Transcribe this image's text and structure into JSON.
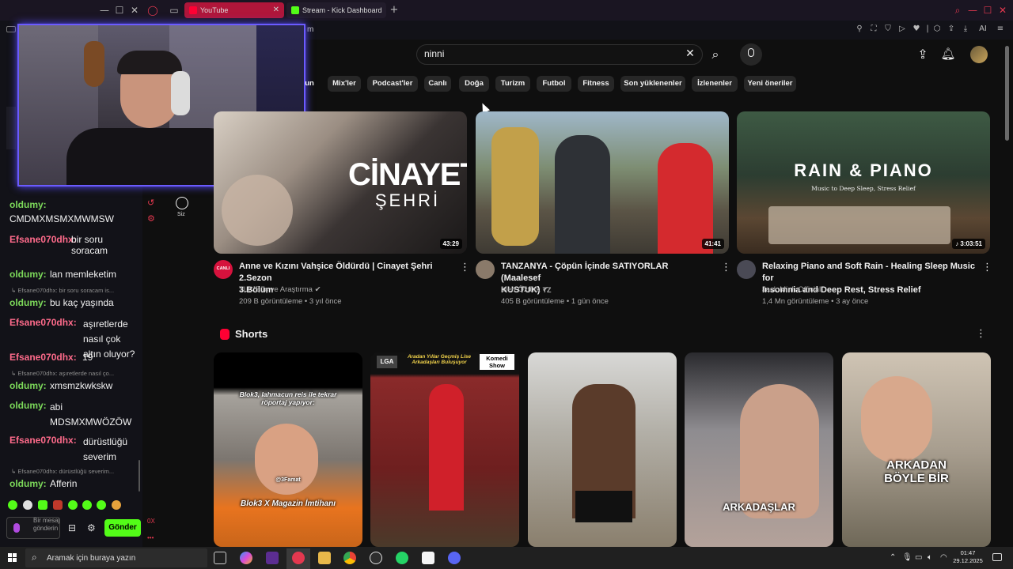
{
  "browser": {
    "tabs": [
      {
        "label": "YouTube",
        "active": true
      },
      {
        "label": "Stream - Kick Dashboard",
        "active": false
      }
    ],
    "new_tab": "+",
    "ai_label": "AI",
    "partial_m": "m"
  },
  "youtube": {
    "search_value": "ninni",
    "chips": [
      "un",
      "Mix'ler",
      "Podcast'ler",
      "Canlı",
      "Doğa",
      "Turizm",
      "Futbol",
      "Fitness",
      "Son yüklenenler",
      "İzlenenler",
      "Yeni öneriler"
    ],
    "sidebar_you_label": "Siz",
    "videos": [
      {
        "title_line1": "Anne ve Kızını Vahşice Öldürdü | Cinayet Şehri 2.Sezon",
        "title_line2": "3.Bölüm",
        "channel": "TLC Suç ve Araştırma",
        "meta": "209 B görüntüleme • 3 yıl önce",
        "duration": "43:29",
        "thumb_text1": "CİNAYET",
        "thumb_text2": "ŞEHRİ",
        "avatar_text": "CANLI"
      },
      {
        "title_line1": "TANZANYA - Çöpün İçinde SATIYORLAR (Maalesef",
        "title_line2": "KUSTUK)",
        "title_suffix": "TZ",
        "channel": "Mert Öztürk",
        "meta": "405 B görüntüleme • 1 gün önce",
        "duration": "41:41"
      },
      {
        "title_line1": "Relaxing Piano and Soft Rain - Healing Sleep Music for",
        "title_line2": "Insomnia and Deep Rest, Stress Relief",
        "channel": "Jack Minh Official",
        "meta": "1,4 Mn görüntüleme • 3 ay önce",
        "duration": "3:03:51",
        "thumb_text1": "RAIN & PIANO",
        "thumb_text2": "Music to Deep Sleep, Stress Relief"
      }
    ],
    "shorts_title": "Shorts",
    "shorts": [
      {
        "caption_top": "Blok3, lahmacun reis ile tekrar röportaj yapıyor:",
        "caption_bottom": "Blok3 X Magazin İmtihanı",
        "handle": "@3Famat"
      },
      {
        "caption_top": "Aradan Yıllar Geçmiş Lise Arkadaşları Buluşuyor",
        "badge": "Komedi Show",
        "logo": "LGA"
      },
      {},
      {
        "caption_bottom": "ARKADAŞLAR"
      },
      {
        "caption_bottom": "ARKADAN BÖYLE BİR"
      }
    ]
  },
  "chat": {
    "messages": [
      {
        "type": "msg",
        "user": "oldumy:",
        "text": "CMDMXMSMXMWMSW",
        "color": "#7cd95a"
      },
      {
        "type": "msg",
        "user": "Efsane070dhx:",
        "text": "bir soru soracam",
        "color": "#ff6b8b"
      },
      {
        "type": "msg",
        "user": "oldumy:",
        "text": "lan memleketim",
        "color": "#7cd95a"
      },
      {
        "type": "reply",
        "text": "↳ Efsane070dhx: bir soru soracam is..."
      },
      {
        "type": "msg",
        "user": "oldumy:",
        "text": "bu kaç yaşında",
        "color": "#7cd95a"
      },
      {
        "type": "msg",
        "user": "Efsane070dhx:",
        "text": "aşıretlerde nasıl çok altın oluyor?",
        "color": "#ff6b8b"
      },
      {
        "type": "msg",
        "user": "Efsane070dhx:",
        "text": "19",
        "color": "#ff6b8b"
      },
      {
        "type": "reply",
        "text": "↳ Efsane070dhx: aşıretlerde nasıl ço..."
      },
      {
        "type": "msg",
        "user": "oldumy:",
        "text": "xmsmzkwkskw",
        "color": "#7cd95a"
      },
      {
        "type": "msg",
        "user": "oldumy:",
        "text": "abi MDSMXMWÖZÖW",
        "color": "#7cd95a"
      },
      {
        "type": "msg",
        "user": "Efsane070dhx:",
        "text": "dürüstlüğü severim",
        "color": "#ff6b8b"
      },
      {
        "type": "reply",
        "text": "↳ Efsane070dhx: dürüstlüğü severim..."
      },
      {
        "type": "msg",
        "user": "oldumy:",
        "text": "Afferin",
        "color": "#7cd95a"
      }
    ],
    "input_placeholder": "Bir mesaj gönderin",
    "send_label": "Gönder",
    "counter": "0X"
  },
  "taskbar": {
    "search_placeholder": "Aramak için buraya yazın",
    "time": "01:47",
    "date": "29.12.2025"
  }
}
